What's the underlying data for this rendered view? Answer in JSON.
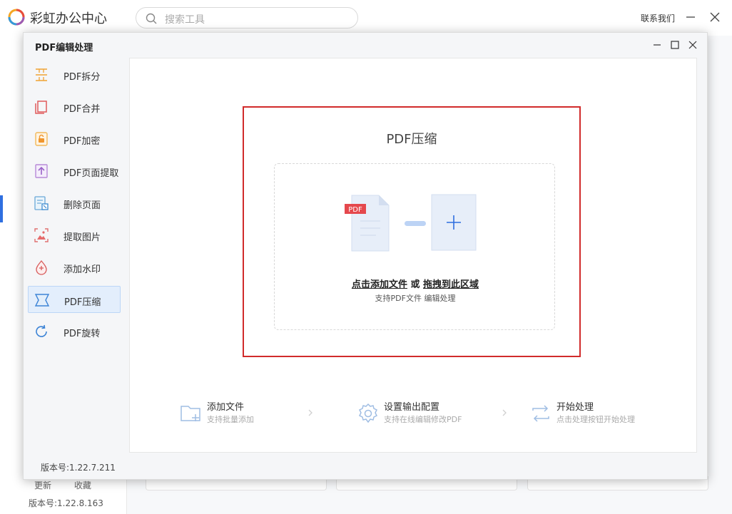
{
  "app": {
    "name": "彩虹办公中心",
    "search_placeholder": "搜索工具",
    "contact": "联系我们",
    "bottom_links": [
      "更新",
      "收藏"
    ],
    "version": "版本号:1.22.8.163"
  },
  "dialog": {
    "title": "PDF编辑处理",
    "version": "版本号:1.22.7.211",
    "menu": [
      {
        "label": "PDF拆分",
        "icon": "split-icon"
      },
      {
        "label": "PDF合并",
        "icon": "merge-icon"
      },
      {
        "label": "PDF加密",
        "icon": "lock-icon"
      },
      {
        "label": "PDF页面提取",
        "icon": "extract-page-icon"
      },
      {
        "label": "删除页面",
        "icon": "delete-page-icon"
      },
      {
        "label": "提取图片",
        "icon": "image-icon"
      },
      {
        "label": "添加水印",
        "icon": "watermark-icon"
      },
      {
        "label": "PDF压缩",
        "icon": "compress-icon",
        "active": true
      },
      {
        "label": "PDF旋转",
        "icon": "rotate-icon"
      }
    ],
    "dropzone": {
      "title": "PDF压缩",
      "badge": "PDF",
      "action_click": "点击添加文件",
      "action_or": " 或 ",
      "action_drag": "拖拽到此区域",
      "subtitle": "支持PDF文件 编辑处理"
    },
    "steps": [
      {
        "title": "添加文件",
        "subtitle": "支持批量添加",
        "icon": "add-folder-icon"
      },
      {
        "title": "设置输出配置",
        "subtitle": "支持在线编辑修改PDF",
        "icon": "settings-icon"
      },
      {
        "title": "开始处理",
        "subtitle": "点击处理按钮开始处理",
        "icon": "process-icon"
      }
    ]
  },
  "colors": {
    "accent": "#2f6fe0",
    "highlight_border": "#d12b2b",
    "pdf_badge": "#e5484d"
  }
}
